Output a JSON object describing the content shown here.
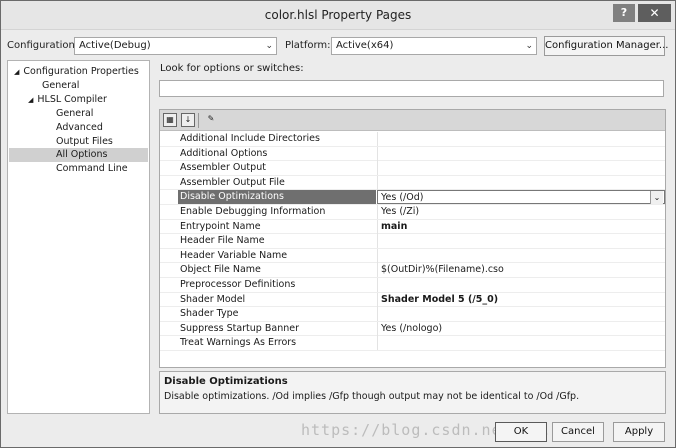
{
  "window": {
    "title": "color.hlsl Property Pages",
    "help_label": "?",
    "close_label": "✕"
  },
  "toolbar": {
    "configuration_label": "Configuration:",
    "configuration_value": "Active(Debug)",
    "platform_label": "Platform:",
    "platform_value": "Active(x64)",
    "config_manager_label": "Configuration Manager..."
  },
  "tree": {
    "root": "Configuration Properties",
    "general": "General",
    "hlsl": "HLSL Compiler",
    "children": [
      "General",
      "Advanced",
      "Output Files",
      "All Options",
      "Command Line"
    ],
    "selected": "All Options"
  },
  "search": {
    "label": "Look for options or switches:",
    "value": ""
  },
  "grid_toolbar": {
    "categorized_icon": "categorized-icon",
    "alphabetical_icon": "alphabetical-icon",
    "property_pages_icon": "wrench-icon"
  },
  "properties": [
    {
      "name": "Additional Include Directories",
      "value": ""
    },
    {
      "name": "Additional Options",
      "value": ""
    },
    {
      "name": "Assembler Output",
      "value": ""
    },
    {
      "name": "Assembler Output File",
      "value": ""
    },
    {
      "name": "Disable Optimizations",
      "value": "Yes (/Od)"
    },
    {
      "name": "Enable Debugging Information",
      "value": "Yes (/Zi)"
    },
    {
      "name": "Entrypoint Name",
      "value": "main"
    },
    {
      "name": "Header File Name",
      "value": ""
    },
    {
      "name": "Header Variable Name",
      "value": ""
    },
    {
      "name": "Object File Name",
      "value": "$(OutDir)%(Filename).cso"
    },
    {
      "name": "Preprocessor Definitions",
      "value": ""
    },
    {
      "name": "Shader Model",
      "value": "Shader Model 5 (/5_0)"
    },
    {
      "name": "Shader Type",
      "value": ""
    },
    {
      "name": "Suppress Startup Banner",
      "value": "Yes (/nologo)"
    },
    {
      "name": "Treat Warnings As Errors",
      "value": ""
    }
  ],
  "selected_property": "Disable Optimizations",
  "description": {
    "title": "Disable Optimizations",
    "text": "Disable optimizations. /Od implies /Gfp though output may not be identical to /Od /Gfp."
  },
  "buttons": {
    "ok": "OK",
    "cancel": "Cancel",
    "apply": "Apply"
  },
  "watermark": "https://blog.csdn.net/..."
}
